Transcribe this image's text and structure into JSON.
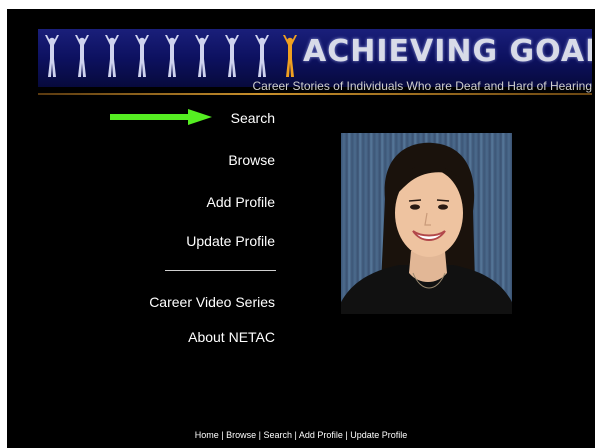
{
  "banner": {
    "title": "ACHIEVING GOALS!",
    "subtitle": "Career Stories of Individuals Who are Deaf and Hard of Hearing"
  },
  "nav": {
    "arrow_icon": "green-arrow-icon",
    "items": [
      {
        "label": "Search"
      },
      {
        "label": "Browse"
      },
      {
        "label": "Add Profile"
      },
      {
        "label": "Update Profile"
      },
      {
        "label": "Career Video Series"
      },
      {
        "label": "About NETAC"
      }
    ]
  },
  "footer": {
    "links": [
      "Home",
      "Browse",
      "Search",
      "Add Profile",
      "Update Profile"
    ],
    "separator": " | "
  },
  "colors": {
    "background": "#000000",
    "banner_blue": "#0d1160",
    "arrow_green": "#55ee22",
    "gold_rule": "#c8902c",
    "highlight_figure": "#f0a020"
  }
}
